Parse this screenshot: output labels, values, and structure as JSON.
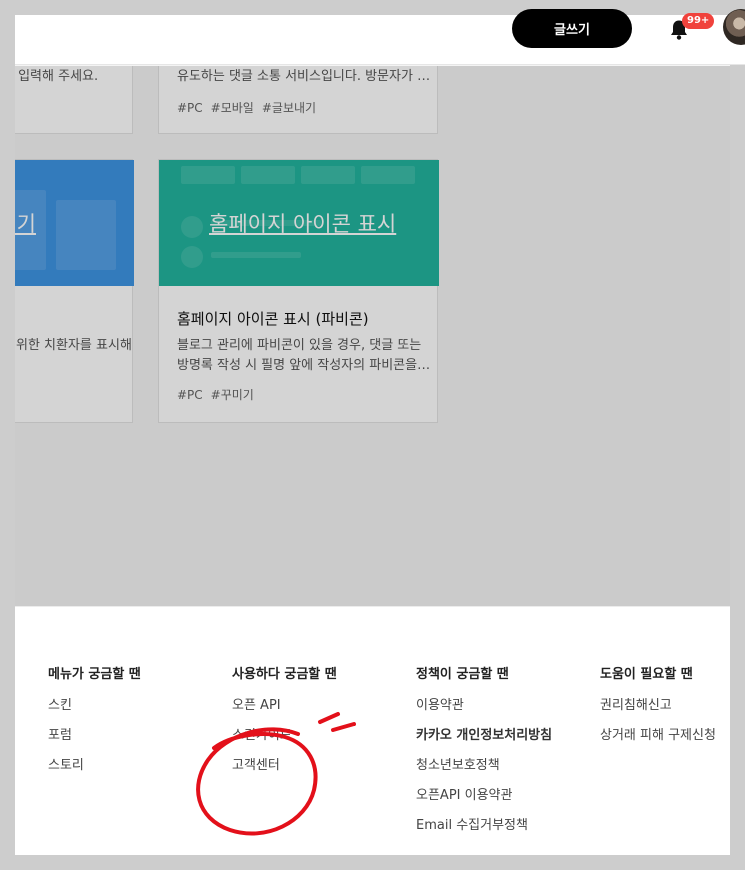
{
  "header": {
    "write_button": "글쓰기",
    "notification_badge": "99+"
  },
  "cards": [
    {
      "desc": "꼭 입력해 주세요.",
      "tags": []
    },
    {
      "desc": "유도하는 댓글 소통 서비스입니다. 방문자가 …",
      "tags": [
        "#PC",
        "#모바일",
        "#글보내기"
      ]
    },
    {
      "thumb_title": "입력기",
      "desc": "위한 치환자를 표시해"
    },
    {
      "thumb_title": "홈페이지 아이콘 표시",
      "title": "홈페이지 아이콘 표시 (파비콘)",
      "desc_line1": "블로그 관리에 파비콘이 있을 경우, 댓글 또는",
      "desc_line2": "방명록 작성 시 필명 앞에 작성자의 파비콘을…",
      "tags": [
        "#PC",
        "#꾸미기"
      ]
    }
  ],
  "footer": {
    "columns": [
      {
        "title": "메뉴가 궁금할 땐",
        "links": [
          "스킨",
          "포럼",
          "스토리"
        ]
      },
      {
        "title": "사용하다 궁금할 땐",
        "links": [
          "오픈 API",
          "스킨가이드",
          "고객센터"
        ]
      },
      {
        "title": "정책이 궁금할 땐",
        "links": [
          "이용약관",
          "카카오 개인정보처리방침",
          "청소년보호정책",
          "오픈API 이용약관",
          "Email 수집거부정책"
        ]
      },
      {
        "title": "도움이 필요할 땐",
        "links": [
          "권리침해신고",
          "상거래 피해 구제신청"
        ]
      }
    ]
  },
  "colors": {
    "accent_badge": "#f0423c",
    "thumb_blue": "#3e94e3",
    "thumb_green": "#22b49e",
    "annotation_red": "#e3101a"
  }
}
